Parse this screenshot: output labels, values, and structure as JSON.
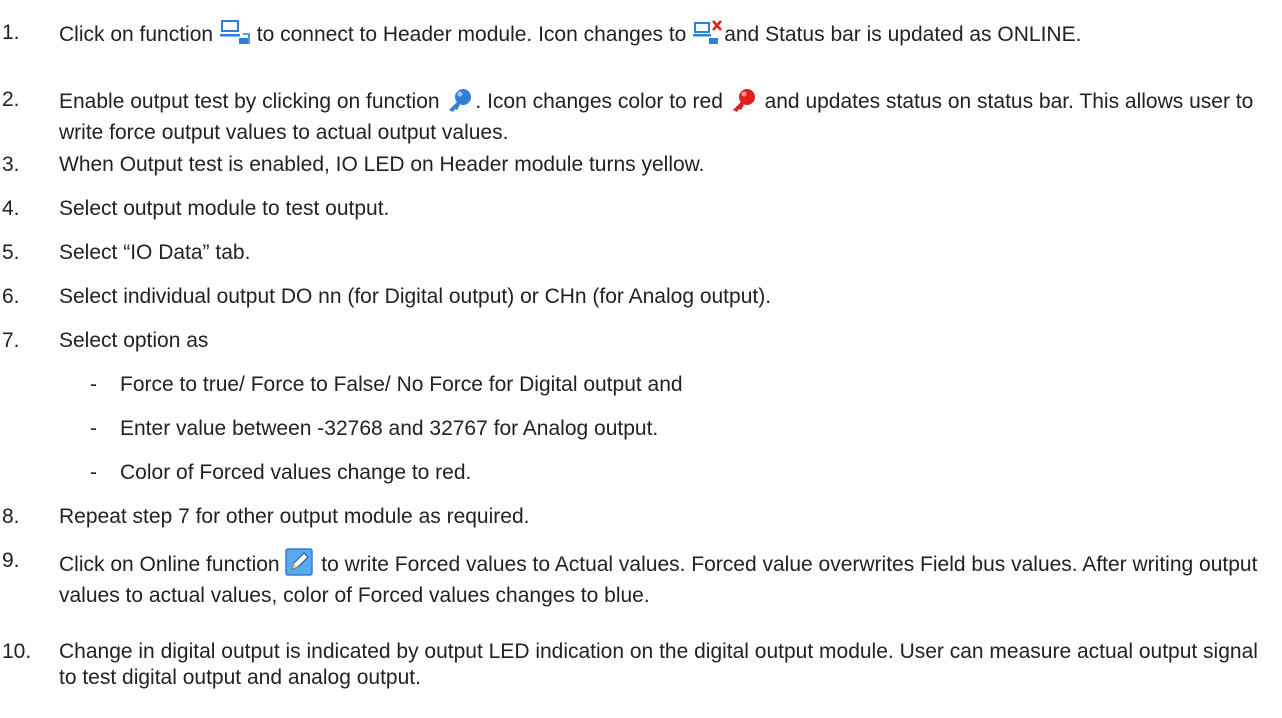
{
  "steps": [
    {
      "num": "1.",
      "a": "Click on function ",
      "b": " to connect to Header module. Icon changes to ",
      "c": "and Status bar is updated as ONLINE.",
      "icon1": "connect-icon",
      "icon2": "disconnect-icon"
    },
    {
      "num": "2.",
      "a": "Enable output test by clicking on function ",
      "b": ". Icon changes color to red ",
      "c": " and updates status on status bar. This allows user to write force output values to actual output values.",
      "icon1": "key-blue-icon",
      "icon2": "key-red-icon"
    },
    {
      "num": "3.",
      "text": "When Output test is enabled, IO LED on Header module turns yellow."
    },
    {
      "num": "4.",
      "text": "Select output module to test output."
    },
    {
      "num": "5.",
      "text": "Select “IO Data” tab."
    },
    {
      "num": "6.",
      "text": "Select individual output DO nn (for Digital output) or CHn (for Analog output)."
    },
    {
      "num": "7.",
      "text": "Select option as"
    },
    {
      "num": "8.",
      "text": "Repeat step 7 for other output module as required."
    },
    {
      "num": "9.",
      "a": "Click on Online function ",
      "b": " to write Forced values to Actual values. Forced value overwrites Field bus values. After writing output values to actual values, color of Forced values changes to blue.",
      "icon1": "edit-write-icon"
    },
    {
      "num": "10.",
      "text": "Change in digital output is indicated by output LED indication on the digital output module. User can measure actual output signal to test digital output and analog output."
    }
  ],
  "sub_items": [
    {
      "dash": "-",
      "text": "Force to true/ Force to False/ No Force for Digital output and"
    },
    {
      "dash": "-",
      "text": "Enter value between -32768 and 32767 for Analog output."
    },
    {
      "dash": "-",
      "text": "Color of Forced values change to red."
    }
  ],
  "colors": {
    "text": "#222222",
    "icon_blue": "#2f7fd8",
    "icon_red": "#e02020"
  }
}
